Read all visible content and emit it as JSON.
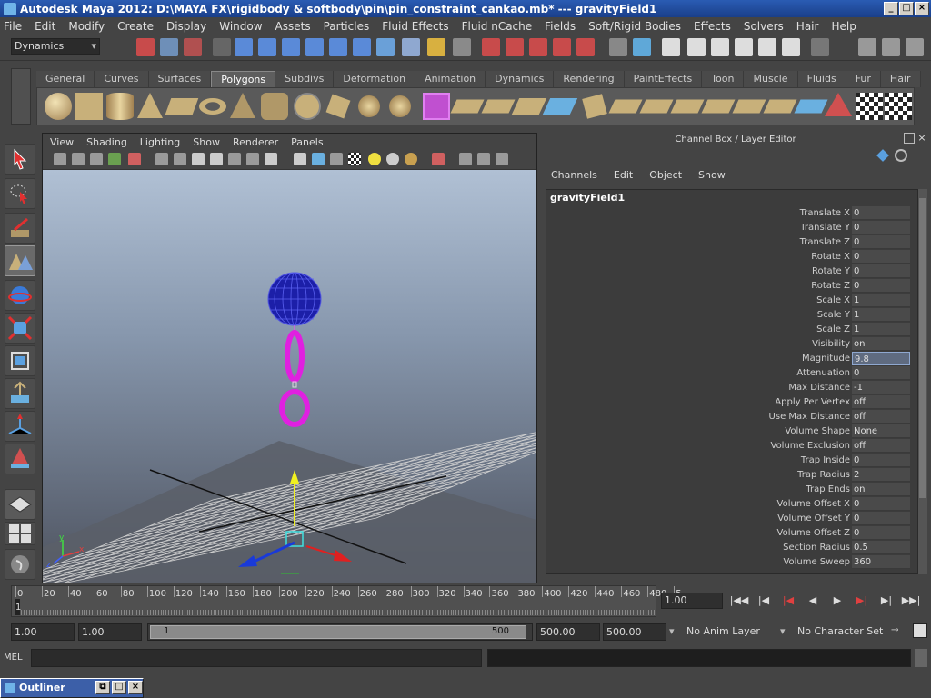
{
  "window": {
    "title": "Autodesk Maya 2012: D:\\MAYA FX\\rigidbody & softbody\\pin\\pin_constraint_cankao.mb*   ---   gravityField1",
    "buttons": {
      "minimize": "_",
      "maximize": "□",
      "close": "×"
    }
  },
  "menubar": [
    "File",
    "Edit",
    "Modify",
    "Create",
    "Display",
    "Window",
    "Assets",
    "Particles",
    "Fluid Effects",
    "Fluid nCache",
    "Fields",
    "Soft/Rigid Bodies",
    "Effects",
    "Solvers",
    "Hair",
    "Help"
  ],
  "statusline": {
    "mode": "Dynamics"
  },
  "shelf": {
    "tabs": [
      "General",
      "Curves",
      "Surfaces",
      "Polygons",
      "Subdivs",
      "Deformation",
      "Animation",
      "Dynamics",
      "Rendering",
      "PaintEffects",
      "Toon",
      "Muscle",
      "Fluids",
      "Fur",
      "Hair"
    ],
    "active_tab": "Polygons"
  },
  "viewport": {
    "menu": [
      "View",
      "Shading",
      "Lighting",
      "Show",
      "Renderer",
      "Panels"
    ],
    "axis_labels": {
      "x": "x",
      "y": "y",
      "z": "z"
    }
  },
  "channel_box": {
    "title": "Channel Box / Layer Editor",
    "menu": [
      "Channels",
      "Edit",
      "Object",
      "Show"
    ],
    "object": "gravityField1",
    "attributes": [
      {
        "name": "Translate X",
        "value": "0"
      },
      {
        "name": "Translate Y",
        "value": "0"
      },
      {
        "name": "Translate Z",
        "value": "0"
      },
      {
        "name": "Rotate X",
        "value": "0"
      },
      {
        "name": "Rotate Y",
        "value": "0"
      },
      {
        "name": "Rotate Z",
        "value": "0"
      },
      {
        "name": "Scale X",
        "value": "1"
      },
      {
        "name": "Scale Y",
        "value": "1"
      },
      {
        "name": "Scale Z",
        "value": "1"
      },
      {
        "name": "Visibility",
        "value": "on"
      },
      {
        "name": "Magnitude",
        "value": "9.8",
        "highlighted": true
      },
      {
        "name": "Attenuation",
        "value": "0"
      },
      {
        "name": "Max Distance",
        "value": "-1"
      },
      {
        "name": "Apply Per Vertex",
        "value": "off"
      },
      {
        "name": "Use Max Distance",
        "value": "off"
      },
      {
        "name": "Volume Shape",
        "value": "None"
      },
      {
        "name": "Volume Exclusion",
        "value": "off"
      },
      {
        "name": "Trap Inside",
        "value": "0"
      },
      {
        "name": "Trap Radius",
        "value": "2"
      },
      {
        "name": "Trap Ends",
        "value": "on"
      },
      {
        "name": "Volume Offset X",
        "value": "0"
      },
      {
        "name": "Volume Offset Y",
        "value": "0"
      },
      {
        "name": "Volume Offset Z",
        "value": "0"
      },
      {
        "name": "Section Radius",
        "value": "0.5"
      },
      {
        "name": "Volume Sweep",
        "value": "360"
      }
    ]
  },
  "timeline": {
    "ticks": [
      "0",
      "20",
      "40",
      "60",
      "80",
      "100",
      "120",
      "140",
      "160",
      "180",
      "200",
      "220",
      "240",
      "260",
      "280",
      "300",
      "320",
      "340",
      "360",
      "380",
      "400",
      "420",
      "440",
      "460",
      "480",
      "5"
    ],
    "current_frame_marker": "1",
    "current_time": "1.00"
  },
  "range": {
    "start": "1.00",
    "playback_start": "1.00",
    "thumb_start": "1",
    "thumb_end": "500",
    "playback_end": "500.00",
    "end": "500.00",
    "anim_layer": "No Anim Layer",
    "character_set": "No Character Set"
  },
  "cmdline": {
    "label": "MEL"
  },
  "taskbar": {
    "outliner": "Outliner"
  },
  "colors": {
    "accent": "#c020c0",
    "title_bar": "#2a5cb3",
    "selection": "#5f6b80"
  }
}
